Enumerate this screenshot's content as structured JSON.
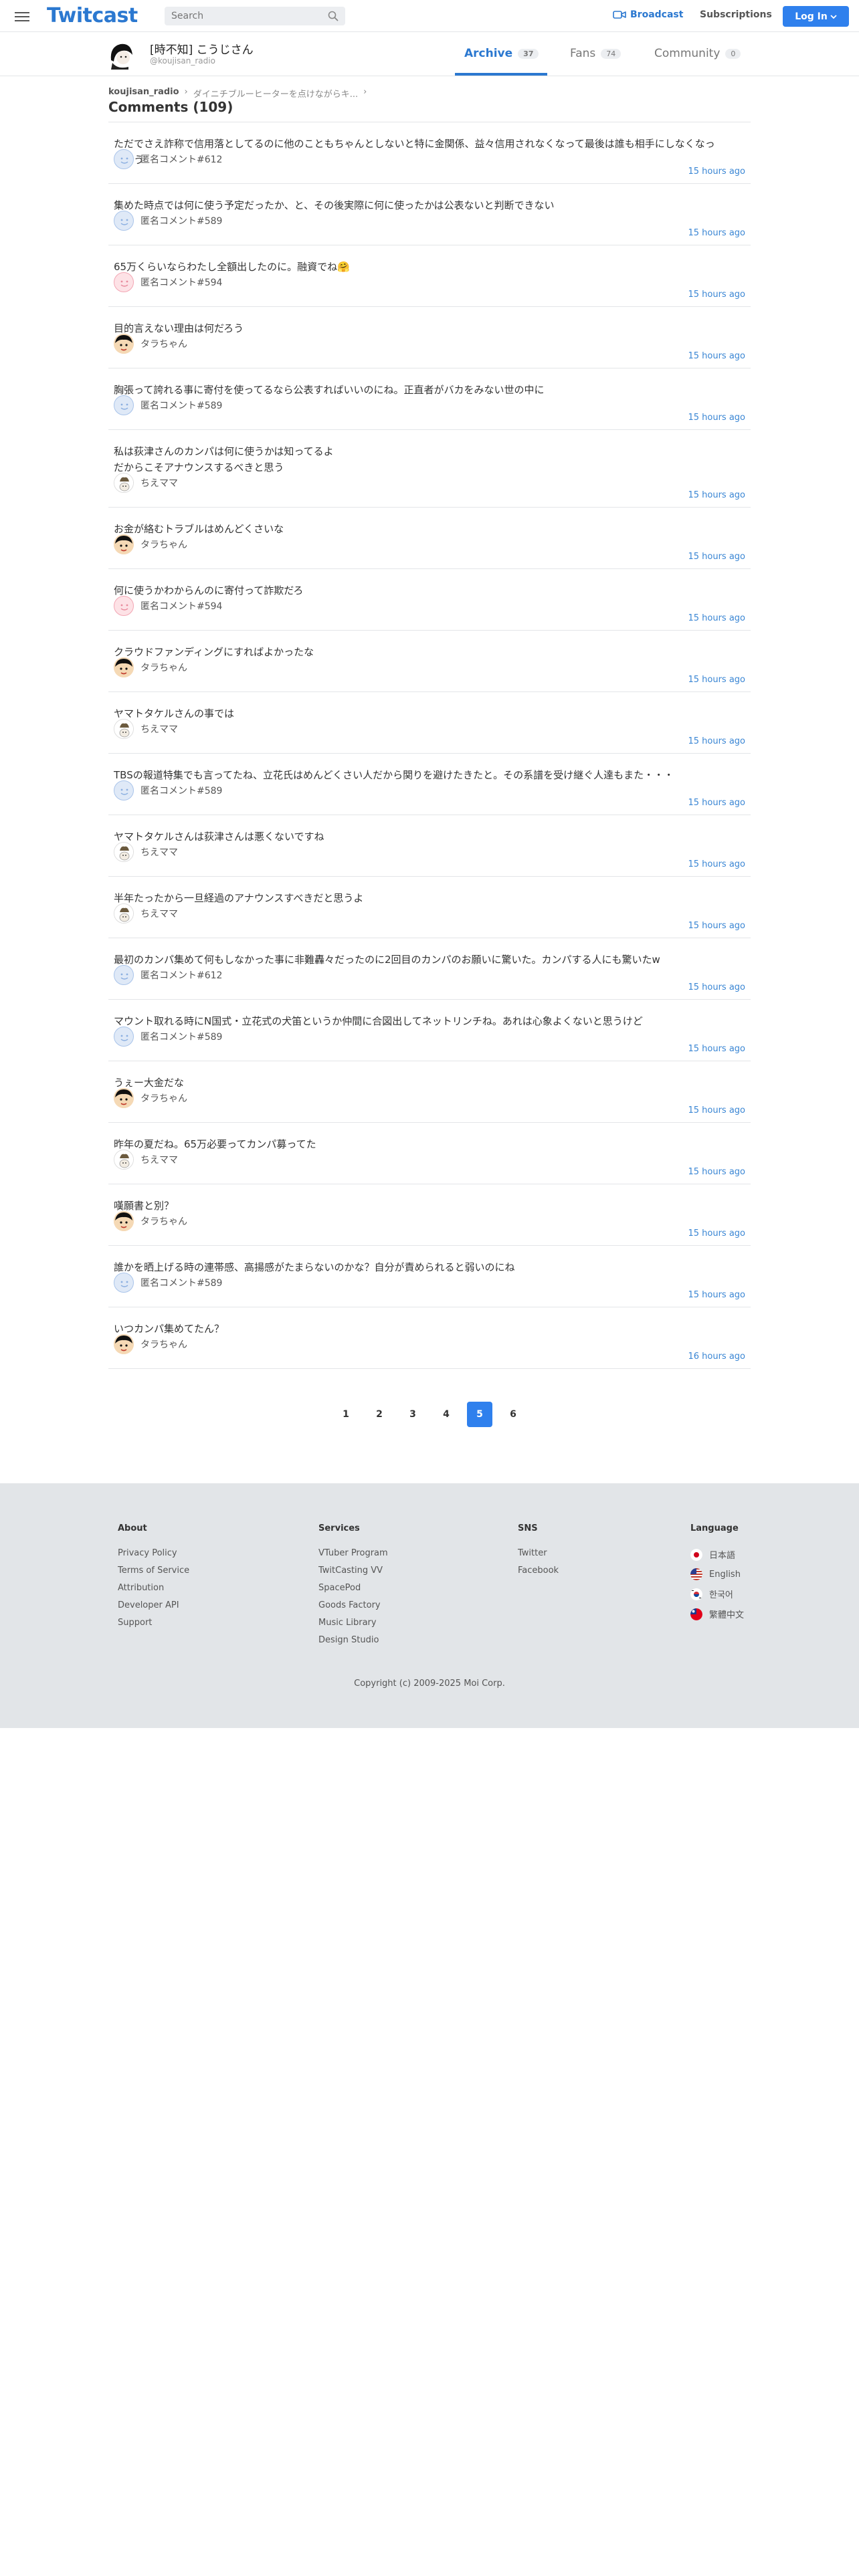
{
  "header": {
    "logo": "Twitcast",
    "search_placeholder": "Search",
    "broadcast": "Broadcast",
    "subscriptions": "Subscriptions",
    "login": "Log In"
  },
  "profile": {
    "name": "[時不知] こうじさん",
    "handle": "@koujisan_radio",
    "tabs": [
      {
        "label": "Archive",
        "count": "37"
      },
      {
        "label": "Fans",
        "count": "74"
      },
      {
        "label": "Community",
        "count": "0"
      }
    ]
  },
  "breadcrumb": {
    "user": "koujisan_radio",
    "separator": "›",
    "page": "ダイニチブルーヒーターを点けながらキ...",
    "trail": "›"
  },
  "comments_title": "Comments (109)",
  "comments": [
    {
      "text": "ただでさえ詐称で信用落としてるのに他のこともちゃんとしないと特に金関係、益々信用されなくなって最後は誰も相手にしなくなっちゃう",
      "user": "匿名コメント#612",
      "avatar": "blue",
      "time": "15 hours ago"
    },
    {
      "text": "集めた時点では何に使う予定だったか、と、その後実際に何に使ったかは公表ないと判断できない",
      "user": "匿名コメント#589",
      "avatar": "blue",
      "time": "15 hours ago"
    },
    {
      "text": "65万くらいならわたし全額出したのに。融資でね🤗",
      "user": "匿名コメント#594",
      "avatar": "pink",
      "time": "15 hours ago"
    },
    {
      "text": "目的言えない理由は何だろう",
      "user": "タラちゃん",
      "avatar": "tara",
      "time": "15 hours ago"
    },
    {
      "text": "胸張って誇れる事に寄付を使ってるなら公表すればいいのにね。正直者がバカをみない世の中に",
      "user": "匿名コメント#589",
      "avatar": "blue",
      "time": "15 hours ago"
    },
    {
      "text": "私は荻津さんのカンパは何に使うかは知ってるよ\nだからこそアナウンスするべきと思う",
      "user": "ちえママ",
      "avatar": "chie",
      "time": "15 hours ago"
    },
    {
      "text": "お金が絡むトラブルはめんどくさいな",
      "user": "タラちゃん",
      "avatar": "tara",
      "time": "15 hours ago"
    },
    {
      "text": "何に使うかわからんのに寄付って詐欺だろ",
      "user": "匿名コメント#594",
      "avatar": "pink",
      "time": "15 hours ago"
    },
    {
      "text": "クラウドファンディングにすればよかったな",
      "user": "タラちゃん",
      "avatar": "tara",
      "time": "15 hours ago"
    },
    {
      "text": "ヤマトタケルさんの事では",
      "user": "ちえママ",
      "avatar": "chie",
      "time": "15 hours ago"
    },
    {
      "text": "TBSの報道特集でも言ってたね、立花氏はめんどくさい人だから関りを避けたきたと。その系譜を受け継ぐ人達もまた・・・",
      "user": "匿名コメント#589",
      "avatar": "blue",
      "time": "15 hours ago"
    },
    {
      "text": "ヤマトタケルさんは荻津さんは悪くないですね",
      "user": "ちえママ",
      "avatar": "chie",
      "time": "15 hours ago"
    },
    {
      "text": "半年たったから一旦経過のアナウンスすべきだと思うよ",
      "user": "ちえママ",
      "avatar": "chie",
      "time": "15 hours ago"
    },
    {
      "text": "最初のカンパ集めて何もしなかった事に非難轟々だったのに2回目のカンパのお願いに驚いた。カンパする人にも驚いたw",
      "user": "匿名コメント#612",
      "avatar": "blue",
      "time": "15 hours ago"
    },
    {
      "text": "マウント取れる時にN国式・立花式の犬笛というか仲間に合図出してネットリンチね。あれは心象よくないと思うけど",
      "user": "匿名コメント#589",
      "avatar": "blue",
      "time": "15 hours ago"
    },
    {
      "text": "うぇー大金だな",
      "user": "タラちゃん",
      "avatar": "tara",
      "time": "15 hours ago"
    },
    {
      "text": "昨年の夏だね。65万必要ってカンパ募ってた",
      "user": "ちえママ",
      "avatar": "chie",
      "time": "15 hours ago"
    },
    {
      "text": "嘆願書と別？",
      "user": "タラちゃん",
      "avatar": "tara",
      "time": "15 hours ago"
    },
    {
      "text": "誰かを晒上げる時の連帯感、高揚感がたまらないのかな？自分が責められると弱いのにね",
      "user": "匿名コメント#589",
      "avatar": "blue",
      "time": "15 hours ago"
    },
    {
      "text": "いつカンパ集めてたん？",
      "user": "タラちゃん",
      "avatar": "tara",
      "time": "16 hours ago"
    }
  ],
  "pagination": {
    "pages": [
      "1",
      "2",
      "3",
      "4",
      "5",
      "6"
    ],
    "current": "5"
  },
  "footer": {
    "about": {
      "heading": "About",
      "links": [
        "Privacy Policy",
        "Terms of Service",
        "Attribution",
        "Developer API",
        "Support"
      ]
    },
    "services": {
      "heading": "Services",
      "links": [
        "VTuber Program",
        "TwitCasting VV",
        "SpacePod",
        "Goods Factory",
        "Music Library",
        "Design Studio"
      ]
    },
    "sns": {
      "heading": "SNS",
      "links": [
        "Twitter",
        "Facebook"
      ]
    },
    "language": {
      "heading": "Language",
      "links": [
        "日本語",
        "English",
        "한국어",
        "繁體中文"
      ]
    },
    "copyright": "Copyright (c) 2009-2025 Moi Corp."
  },
  "colors": {
    "brand": "#2b78d0",
    "primary_button": "#2f80ed",
    "timestamp": "#3a86d4",
    "footer_bg": "#e2e5e8"
  }
}
